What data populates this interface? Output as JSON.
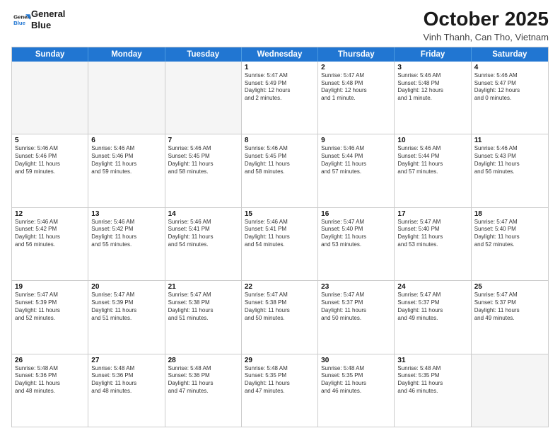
{
  "logo": {
    "line1": "General",
    "line2": "Blue"
  },
  "title": "October 2025",
  "subtitle": "Vinh Thanh, Can Tho, Vietnam",
  "days": [
    "Sunday",
    "Monday",
    "Tuesday",
    "Wednesday",
    "Thursday",
    "Friday",
    "Saturday"
  ],
  "weeks": [
    [
      {
        "day": "",
        "info": ""
      },
      {
        "day": "",
        "info": ""
      },
      {
        "day": "",
        "info": ""
      },
      {
        "day": "1",
        "info": "Sunrise: 5:47 AM\nSunset: 5:49 PM\nDaylight: 12 hours\nand 2 minutes."
      },
      {
        "day": "2",
        "info": "Sunrise: 5:47 AM\nSunset: 5:48 PM\nDaylight: 12 hours\nand 1 minute."
      },
      {
        "day": "3",
        "info": "Sunrise: 5:46 AM\nSunset: 5:48 PM\nDaylight: 12 hours\nand 1 minute."
      },
      {
        "day": "4",
        "info": "Sunrise: 5:46 AM\nSunset: 5:47 PM\nDaylight: 12 hours\nand 0 minutes."
      }
    ],
    [
      {
        "day": "5",
        "info": "Sunrise: 5:46 AM\nSunset: 5:46 PM\nDaylight: 11 hours\nand 59 minutes."
      },
      {
        "day": "6",
        "info": "Sunrise: 5:46 AM\nSunset: 5:46 PM\nDaylight: 11 hours\nand 59 minutes."
      },
      {
        "day": "7",
        "info": "Sunrise: 5:46 AM\nSunset: 5:45 PM\nDaylight: 11 hours\nand 58 minutes."
      },
      {
        "day": "8",
        "info": "Sunrise: 5:46 AM\nSunset: 5:45 PM\nDaylight: 11 hours\nand 58 minutes."
      },
      {
        "day": "9",
        "info": "Sunrise: 5:46 AM\nSunset: 5:44 PM\nDaylight: 11 hours\nand 57 minutes."
      },
      {
        "day": "10",
        "info": "Sunrise: 5:46 AM\nSunset: 5:44 PM\nDaylight: 11 hours\nand 57 minutes."
      },
      {
        "day": "11",
        "info": "Sunrise: 5:46 AM\nSunset: 5:43 PM\nDaylight: 11 hours\nand 56 minutes."
      }
    ],
    [
      {
        "day": "12",
        "info": "Sunrise: 5:46 AM\nSunset: 5:42 PM\nDaylight: 11 hours\nand 56 minutes."
      },
      {
        "day": "13",
        "info": "Sunrise: 5:46 AM\nSunset: 5:42 PM\nDaylight: 11 hours\nand 55 minutes."
      },
      {
        "day": "14",
        "info": "Sunrise: 5:46 AM\nSunset: 5:41 PM\nDaylight: 11 hours\nand 54 minutes."
      },
      {
        "day": "15",
        "info": "Sunrise: 5:46 AM\nSunset: 5:41 PM\nDaylight: 11 hours\nand 54 minutes."
      },
      {
        "day": "16",
        "info": "Sunrise: 5:47 AM\nSunset: 5:40 PM\nDaylight: 11 hours\nand 53 minutes."
      },
      {
        "day": "17",
        "info": "Sunrise: 5:47 AM\nSunset: 5:40 PM\nDaylight: 11 hours\nand 53 minutes."
      },
      {
        "day": "18",
        "info": "Sunrise: 5:47 AM\nSunset: 5:40 PM\nDaylight: 11 hours\nand 52 minutes."
      }
    ],
    [
      {
        "day": "19",
        "info": "Sunrise: 5:47 AM\nSunset: 5:39 PM\nDaylight: 11 hours\nand 52 minutes."
      },
      {
        "day": "20",
        "info": "Sunrise: 5:47 AM\nSunset: 5:39 PM\nDaylight: 11 hours\nand 51 minutes."
      },
      {
        "day": "21",
        "info": "Sunrise: 5:47 AM\nSunset: 5:38 PM\nDaylight: 11 hours\nand 51 minutes."
      },
      {
        "day": "22",
        "info": "Sunrise: 5:47 AM\nSunset: 5:38 PM\nDaylight: 11 hours\nand 50 minutes."
      },
      {
        "day": "23",
        "info": "Sunrise: 5:47 AM\nSunset: 5:37 PM\nDaylight: 11 hours\nand 50 minutes."
      },
      {
        "day": "24",
        "info": "Sunrise: 5:47 AM\nSunset: 5:37 PM\nDaylight: 11 hours\nand 49 minutes."
      },
      {
        "day": "25",
        "info": "Sunrise: 5:47 AM\nSunset: 5:37 PM\nDaylight: 11 hours\nand 49 minutes."
      }
    ],
    [
      {
        "day": "26",
        "info": "Sunrise: 5:48 AM\nSunset: 5:36 PM\nDaylight: 11 hours\nand 48 minutes."
      },
      {
        "day": "27",
        "info": "Sunrise: 5:48 AM\nSunset: 5:36 PM\nDaylight: 11 hours\nand 48 minutes."
      },
      {
        "day": "28",
        "info": "Sunrise: 5:48 AM\nSunset: 5:36 PM\nDaylight: 11 hours\nand 47 minutes."
      },
      {
        "day": "29",
        "info": "Sunrise: 5:48 AM\nSunset: 5:35 PM\nDaylight: 11 hours\nand 47 minutes."
      },
      {
        "day": "30",
        "info": "Sunrise: 5:48 AM\nSunset: 5:35 PM\nDaylight: 11 hours\nand 46 minutes."
      },
      {
        "day": "31",
        "info": "Sunrise: 5:48 AM\nSunset: 5:35 PM\nDaylight: 11 hours\nand 46 minutes."
      },
      {
        "day": "",
        "info": ""
      }
    ]
  ]
}
